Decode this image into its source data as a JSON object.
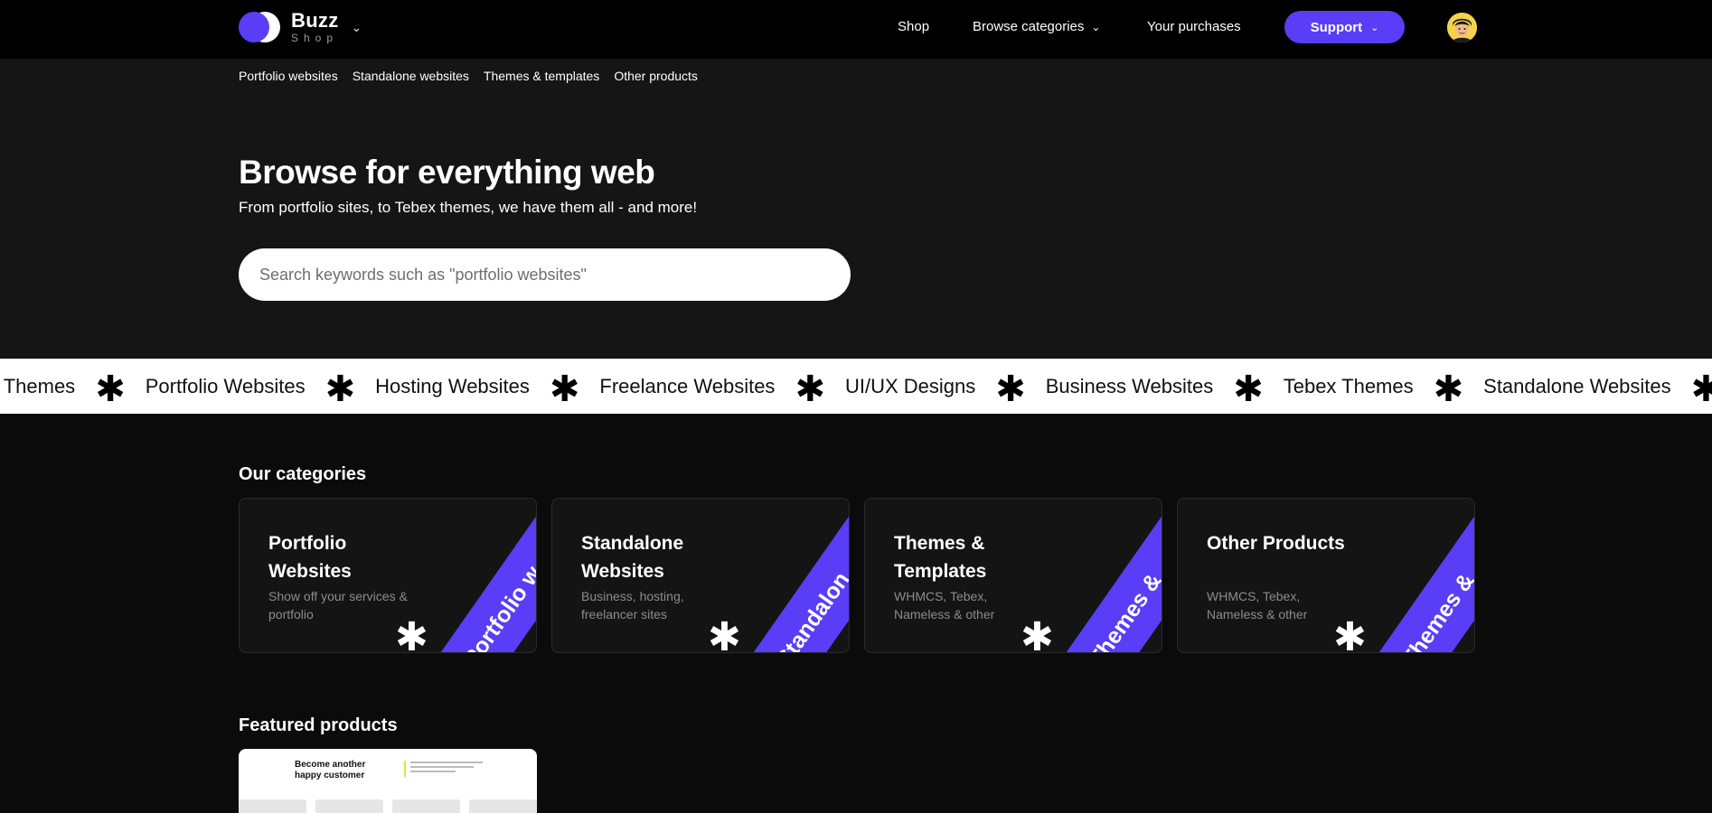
{
  "brand": {
    "name": "Buzz",
    "sub": "Shop"
  },
  "nav": {
    "shop": "Shop",
    "browse": "Browse categories",
    "purchases": "Your purchases",
    "support": "Support"
  },
  "subnav": [
    "Portfolio websites",
    "Standalone websites",
    "Themes & templates",
    "Other products"
  ],
  "hero": {
    "title": "Browse for everything web",
    "subtitle": "From portfolio sites, to Tebex themes, we have them all - and more!",
    "search_placeholder": "Search keywords such as \"portfolio websites\""
  },
  "marquee": [
    "tyl Themes",
    "Portfolio Websites",
    "Hosting Websites",
    "Freelance Websites",
    "UI/UX Designs",
    "Business Websites",
    "Tebex Themes",
    "Standalone Websites"
  ],
  "categories": {
    "title": "Our categories",
    "items": [
      {
        "title": "Portfolio Websites",
        "desc": "Show off your services & portfolio",
        "ribbon": "Portfolio w"
      },
      {
        "title": "Standalone Websites",
        "desc": "Business, hosting, freelancer sites",
        "ribbon": "Standalon"
      },
      {
        "title": "Themes & Templates",
        "desc": "WHMCS, Tebex, Nameless & other",
        "ribbon": "Themes &"
      },
      {
        "title": "Other Products",
        "desc": "WHMCS, Tebex, Nameless & other",
        "ribbon": "Themes &"
      }
    ]
  },
  "featured": {
    "title": "Featured products",
    "preview_heading": "Become another happy customer"
  },
  "colors": {
    "accent": "#5a3df6",
    "nav_bg": "#000000",
    "hero_bg": "#151515",
    "page_bg": "#0b0b0b"
  }
}
